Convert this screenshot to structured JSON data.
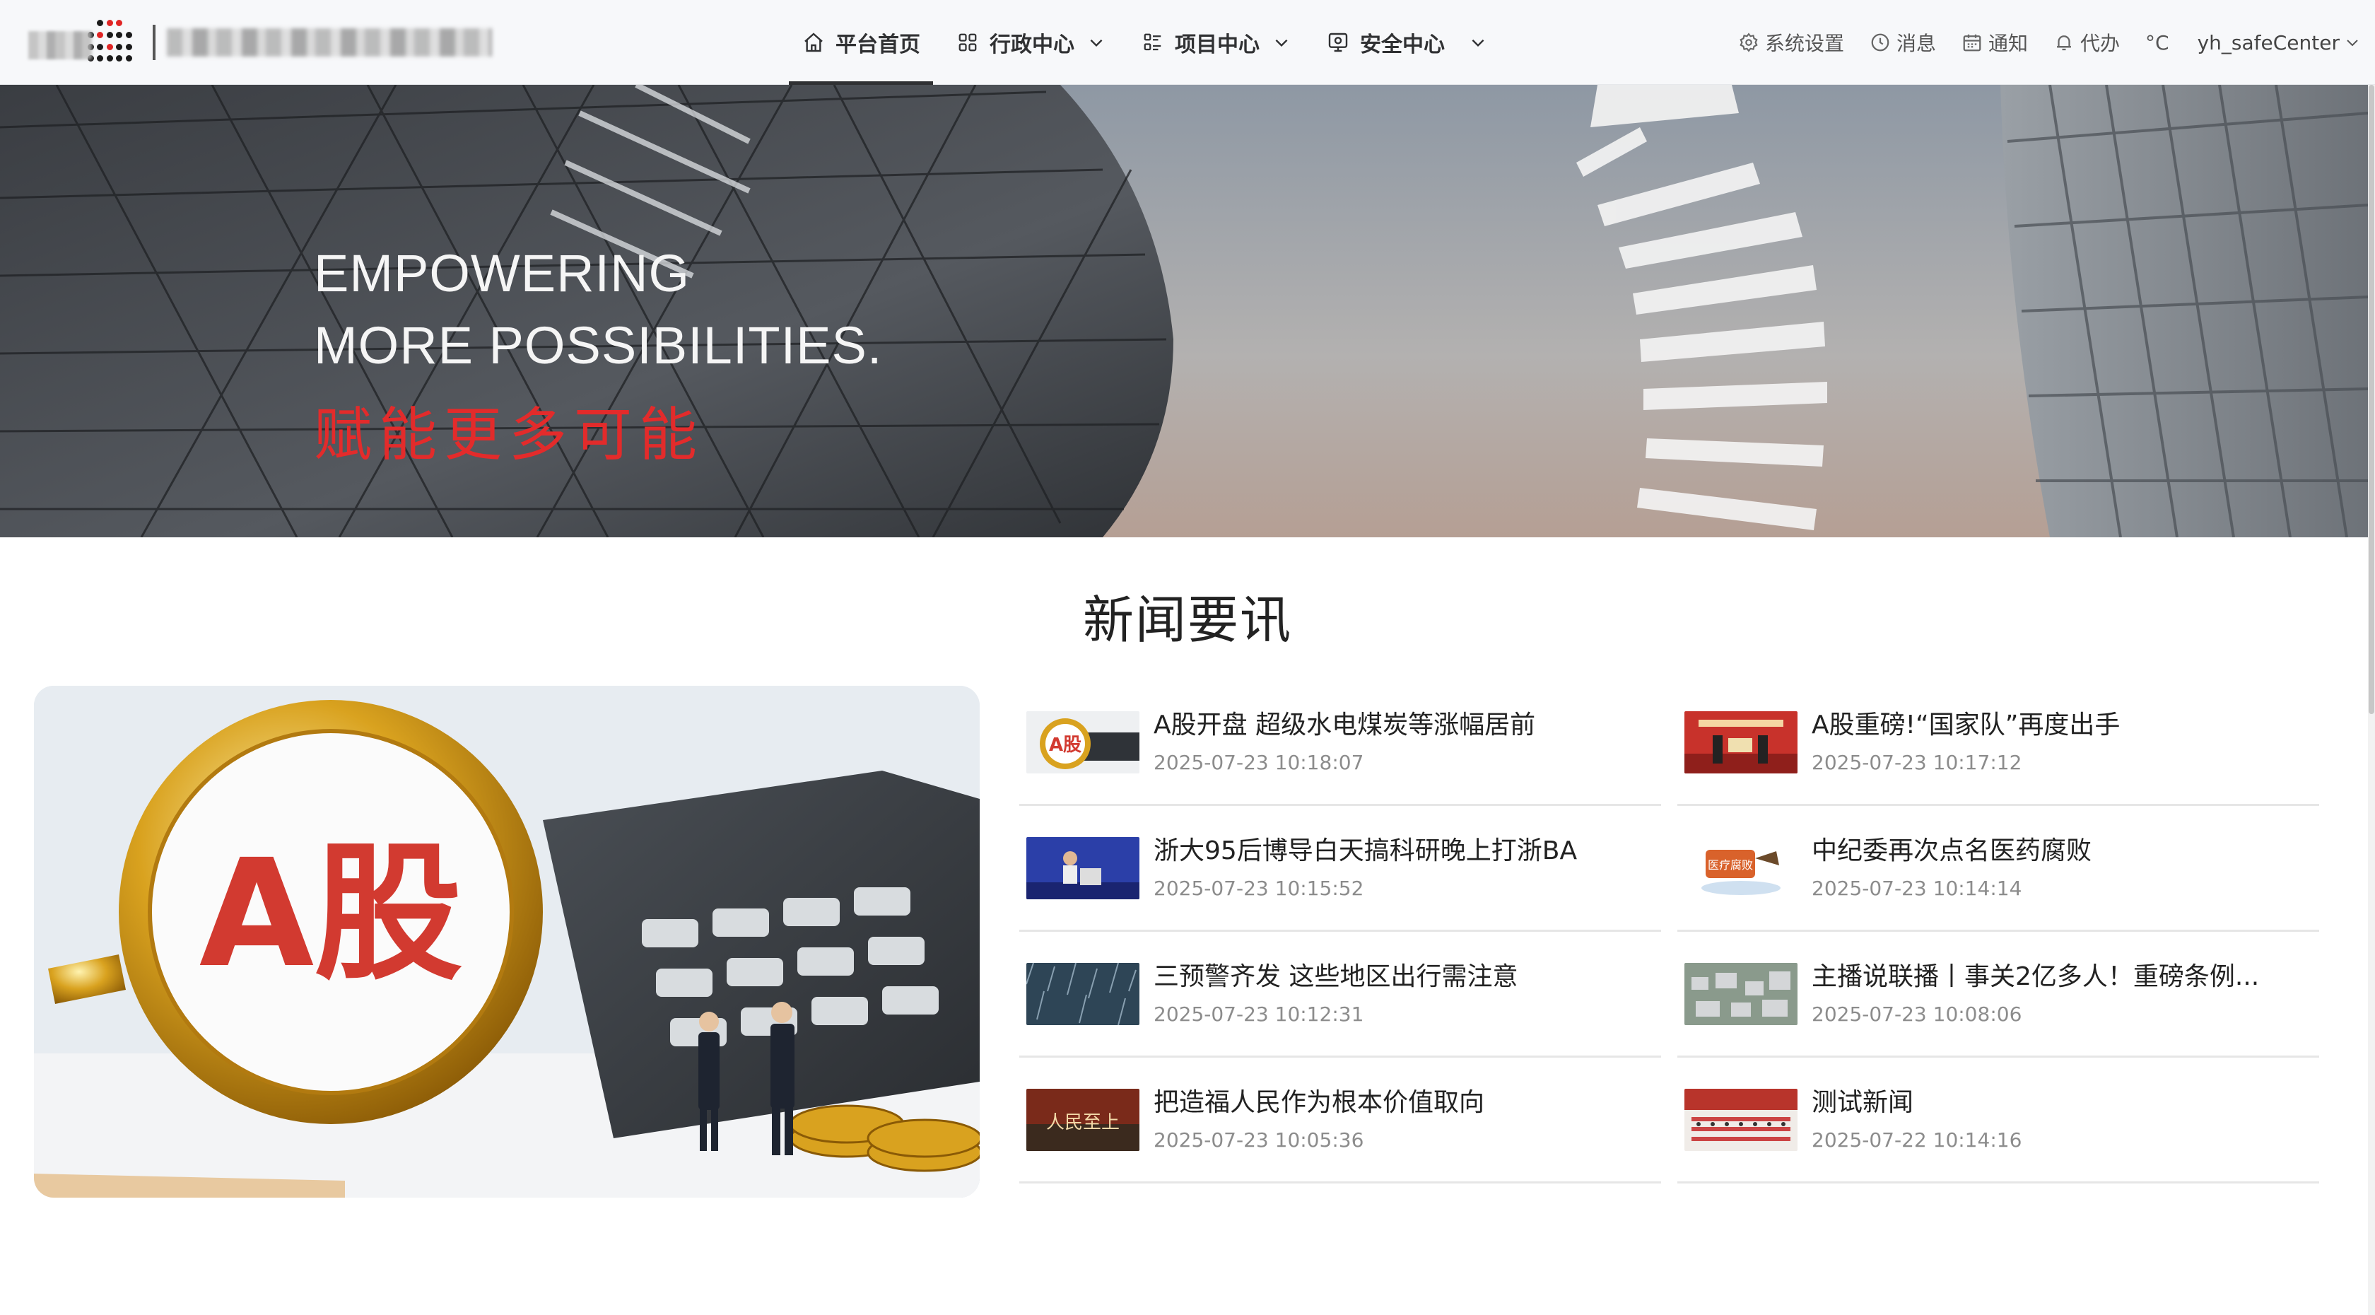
{
  "header": {
    "nav": [
      {
        "label": "平台首页",
        "icon": "home-icon",
        "active": true
      },
      {
        "label": "行政中心",
        "icon": "grid-icon",
        "dropdown": true
      },
      {
        "label": "项目中心",
        "icon": "list-icon",
        "dropdown": true
      },
      {
        "label": "安全中心",
        "icon": "monitor-icon",
        "dropdown": true
      }
    ],
    "tools": {
      "settings": "系统设置",
      "messages": "消息",
      "notices": "通知",
      "todo": "代办",
      "weather": "°C",
      "user": "yh_safeCenter"
    }
  },
  "banner": {
    "line1": "EMPOWERING",
    "line2": "MORE POSSIBILITIES.",
    "line3": "赋能更多可能"
  },
  "news": {
    "title": "新闻要讯",
    "feature_image_text": "A股",
    "items": [
      {
        "title": "A股开盘 超级水电煤炭等涨幅居前",
        "time": "2025-07-23 10:18:07"
      },
      {
        "title": "A股重磅!“国家队”再度出手",
        "time": "2025-07-23 10:17:12"
      },
      {
        "title": "浙大95后博导白天搞科研晚上打浙BA",
        "time": "2025-07-23 10:15:52"
      },
      {
        "title": "中纪委再次点名医药腐败",
        "time": "2025-07-23 10:14:14"
      },
      {
        "title": "三预警齐发 这些地区出行需注意",
        "time": "2025-07-23 10:12:31"
      },
      {
        "title": "主播说联播丨事关2亿多人！重磅条例...",
        "time": "2025-07-23 10:08:06"
      },
      {
        "title": "把造福人民作为根本价值取向",
        "time": "2025-07-23 10:05:36"
      },
      {
        "title": "测试新闻",
        "time": "2025-07-22 10:14:16"
      }
    ],
    "thumb_texts": {
      "item0": "A股",
      "item3": "医疗腐败",
      "item6": "人民至上"
    }
  },
  "colors": {
    "accent_red": "#e32b2b",
    "nav_text": "#303133",
    "muted": "#8c8c8c"
  }
}
